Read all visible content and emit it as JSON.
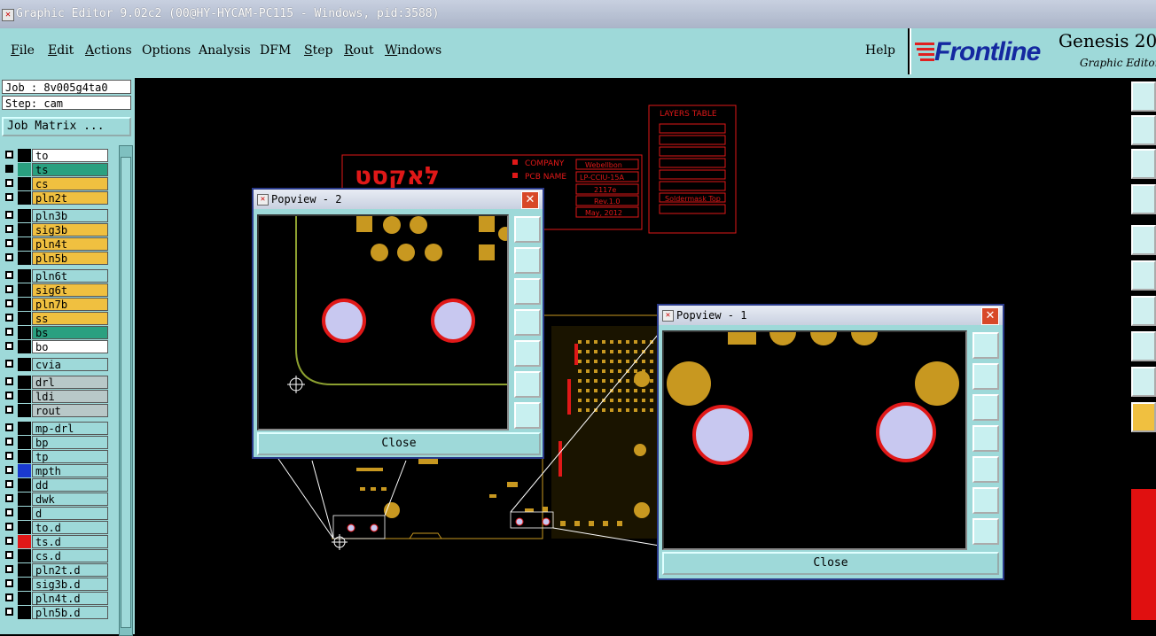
{
  "window": {
    "title": "Graphic Editor 9.02c2 (00@HY-HYCAM-PC115 - Windows, pid:3588)"
  },
  "menu": {
    "file": "File",
    "edit": "Edit",
    "actions": "Actions",
    "options": "Options",
    "analysis": "Analysis",
    "dfm": "DFM",
    "step": "Step",
    "rout": "Rout",
    "windows": "Windows",
    "help": "Help"
  },
  "brand": {
    "company": "Frontline",
    "product": "Genesis 20",
    "subtitle": "Graphic Editor"
  },
  "job": {
    "job_line": "Job : 8v005g4ta0",
    "step_line": "Step: cam",
    "matrix_button": "Job Matrix ..."
  },
  "layers": [
    {
      "name": "to",
      "color": "#ffffff",
      "checked": false,
      "swatch": "#000000"
    },
    {
      "name": "ts",
      "color": "#2aa080",
      "checked": true,
      "swatch": "#2aa080"
    },
    {
      "name": "cs",
      "color": "#f0c040",
      "checked": false,
      "swatch": "#000000"
    },
    {
      "name": "pln2t",
      "color": "#f0c040",
      "checked": false,
      "swatch": "#000000"
    },
    {
      "name": "pln3b",
      "color": "#9ed9d9",
      "checked": false,
      "swatch": "#000000"
    },
    {
      "name": "sig3b",
      "color": "#f0c040",
      "checked": false,
      "swatch": "#000000"
    },
    {
      "name": "pln4t",
      "color": "#f0c040",
      "checked": false,
      "swatch": "#000000"
    },
    {
      "name": "pln5b",
      "color": "#f0c040",
      "checked": false,
      "swatch": "#000000"
    },
    {
      "name": "pln6t",
      "color": "#9ed9d9",
      "checked": false,
      "swatch": "#000000"
    },
    {
      "name": "sig6t",
      "color": "#f0c040",
      "checked": false,
      "swatch": "#000000"
    },
    {
      "name": "pln7b",
      "color": "#f0c040",
      "checked": false,
      "swatch": "#000000"
    },
    {
      "name": "ss",
      "color": "#f0c040",
      "checked": false,
      "swatch": "#000000"
    },
    {
      "name": "bs",
      "color": "#2aa080",
      "checked": false,
      "swatch": "#000000"
    },
    {
      "name": "bo",
      "color": "#ffffff",
      "checked": false,
      "swatch": "#000000"
    },
    {
      "name": "cvia",
      "color": "#9ed9d9",
      "checked": false,
      "swatch": "#000000"
    },
    {
      "name": "drl",
      "color": "#b8c8c8",
      "checked": false,
      "swatch": "#000000"
    },
    {
      "name": "ldi",
      "color": "#b8c8c8",
      "checked": false,
      "swatch": "#000000"
    },
    {
      "name": "rout",
      "color": "#b8c8c8",
      "checked": false,
      "swatch": "#000000"
    },
    {
      "name": "mp-drl",
      "color": "#9ed9d9",
      "checked": false,
      "swatch": "#000000"
    },
    {
      "name": "bp",
      "color": "#9ed9d9",
      "checked": false,
      "swatch": "#000000"
    },
    {
      "name": "tp",
      "color": "#9ed9d9",
      "checked": false,
      "swatch": "#000000"
    },
    {
      "name": "mpth",
      "color": "#9ed9d9",
      "checked": false,
      "swatch": "#1a3ad0"
    },
    {
      "name": "dd",
      "color": "#9ed9d9",
      "checked": false,
      "swatch": "#000000"
    },
    {
      "name": "dwk",
      "color": "#9ed9d9",
      "checked": false,
      "swatch": "#000000"
    },
    {
      "name": "d",
      "color": "#9ed9d9",
      "checked": false,
      "swatch": "#000000"
    },
    {
      "name": "to.d",
      "color": "#9ed9d9",
      "checked": false,
      "swatch": "#000000"
    },
    {
      "name": "ts.d",
      "color": "#9ed9d9",
      "checked": false,
      "swatch": "#e01818"
    },
    {
      "name": "cs.d",
      "color": "#9ed9d9",
      "checked": false,
      "swatch": "#000000"
    },
    {
      "name": "pln2t.d",
      "color": "#9ed9d9",
      "checked": false,
      "swatch": "#000000"
    },
    {
      "name": "sig3b.d",
      "color": "#9ed9d9",
      "checked": false,
      "swatch": "#000000"
    },
    {
      "name": "pln4t.d",
      "color": "#9ed9d9",
      "checked": false,
      "swatch": "#000000"
    },
    {
      "name": "pln5b.d",
      "color": "#9ed9d9",
      "checked": false,
      "swatch": "#000000"
    }
  ],
  "board": {
    "layers_table_title": "LAYERS TABLE",
    "layers_table_entry": "Soldermask Top",
    "info_labels": [
      "COMPANY",
      "PCB NAME"
    ],
    "info_values": [
      "Webellbon",
      "LP-CCIU-15A",
      "2117e",
      "Rev.1.0",
      "May, 2012"
    ],
    "logo_text": "לּאקסט"
  },
  "popview2": {
    "title": "Popview - 2",
    "close_label": "Close"
  },
  "popview1": {
    "title": "Popview - 1",
    "close_label": "Close"
  },
  "colors": {
    "pad": "#c89820",
    "hole": "#c8c8f0",
    "ring": "#e01818",
    "outline": "#8ca030",
    "menubar": "#9ed9d9"
  }
}
